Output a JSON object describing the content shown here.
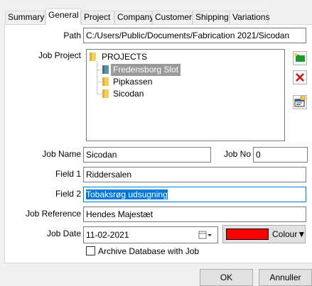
{
  "tabs": [
    {
      "label": "Summary",
      "active": false
    },
    {
      "label": "General",
      "active": true
    },
    {
      "label": "Project",
      "active": false
    },
    {
      "label": "Company",
      "active": false
    },
    {
      "label": "Customer",
      "active": false
    },
    {
      "label": "Shipping",
      "active": false
    },
    {
      "label": "Variations",
      "active": false
    }
  ],
  "form": {
    "path_label": "Path",
    "path_value": "C:/Users/Public/Documents/Fabrication 2021/Sicodan",
    "job_project_label": "Job Project",
    "tree": {
      "root": "PROJECTS",
      "children": [
        {
          "label": "Fredensborg Slot",
          "selected": true
        },
        {
          "label": "Pipkassen",
          "selected": false
        },
        {
          "label": "Sicodan",
          "selected": false
        }
      ]
    },
    "side_buttons": {
      "add_icon": "folder-add-icon",
      "delete_icon": "delete-x-icon",
      "props_icon": "properties-icon"
    },
    "job_name_label": "Job Name",
    "job_name_value": "Sicodan",
    "job_no_label": "Job No",
    "job_no_value": "0",
    "field1_label": "Field 1",
    "field1_value": "Riddersalen",
    "field2_label": "Field 2",
    "field2_value": "Tobaksrøg udsugning",
    "job_reference_label": "Job Reference",
    "job_reference_value": "Hendes Majestæt",
    "job_date_label": "Job Date",
    "job_date_value": "11-02-2021",
    "colour_label": "Colour",
    "colour_value": "#ff0000",
    "archive_label": "Archive Database with Job",
    "archive_checked": false
  },
  "footer": {
    "ok_label": "OK",
    "cancel_label": "Annuller"
  }
}
